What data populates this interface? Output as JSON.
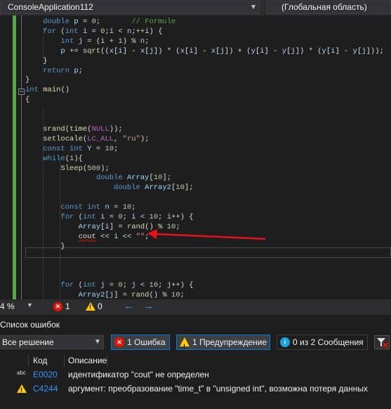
{
  "nav": {
    "project": "ConsoleApplication112",
    "scope": "(Глобальная область)"
  },
  "code_lines": [
    {
      "text": "    double p = 0;       // Formule"
    },
    {
      "text": "    for (int i = 0;i < n;++i) {"
    },
    {
      "text": "        int j = (i + 1) % n;"
    },
    {
      "text": "        p += sqrt((x[i] - x[j]) * (x[i] - x[j]) + (y[i] - y[j]) * (y[i] - y[j]));"
    },
    {
      "text": "    }"
    },
    {
      "text": "    return p;"
    },
    {
      "text": "}"
    },
    {
      "text": "int main()"
    },
    {
      "text": "{"
    },
    {
      "text": ""
    },
    {
      "text": ""
    },
    {
      "text": "    srand(time(NULL));"
    },
    {
      "text": "    setlocale(LC_ALL, \"ru\");"
    },
    {
      "text": "    const int Y = 10;"
    },
    {
      "text": "    while(1){"
    },
    {
      "text": "        Sleep(500);"
    },
    {
      "text": "                double Array[10];"
    },
    {
      "text": "                    double Array2[10];"
    },
    {
      "text": ""
    },
    {
      "text": "        const int n = 10;"
    },
    {
      "text": "        for (int i = 0; i < 10; i++) {"
    },
    {
      "text": "            Array[i] = rand() % 10;"
    },
    {
      "text": "            cout << i << \"\";"
    },
    {
      "text": "        }"
    },
    {
      "text": ""
    },
    {
      "text": ""
    },
    {
      "text": ""
    },
    {
      "text": "        for (int j = 0; j < 10; j++) {"
    },
    {
      "text": "            Array2[j] = rand() % 10;"
    },
    {
      "text": "        }"
    }
  ],
  "status": {
    "zoom": "4 %",
    "error_count": "1",
    "warning_count": "0"
  },
  "error_list": {
    "title": "Список ошибок",
    "scope": "Все решение",
    "filter_errors": "1 Ошибка",
    "filter_warnings": "1 Предупреждение",
    "filter_messages": "0 из 2 Сообщения",
    "col_code": "Код",
    "col_desc": "Описание",
    "rows": [
      {
        "code": "E0020",
        "desc": "идентификатор \"cout\" не определен",
        "kind": "error"
      },
      {
        "code": "C4244",
        "desc": "аргумент: преобразование \"time_t\" в \"unsigned int\", возможна потеря данных",
        "kind": "warning"
      }
    ]
  },
  "colors": {
    "keyword": "#569cd6",
    "error": "#e51400",
    "warning": "#ffcc00",
    "info": "#1ba1e2",
    "link": "#3794ff",
    "annotation_arrow": "#e8101a"
  }
}
